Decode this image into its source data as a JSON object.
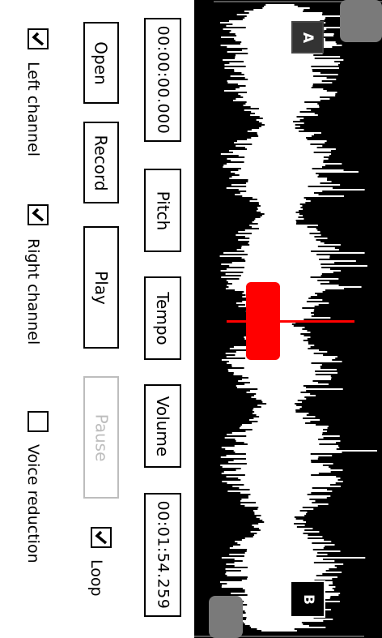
{
  "controls": {
    "open_label": "Open",
    "record_label": "Record",
    "play_label": "Play",
    "pause_label": "Pause",
    "pitch_label": "Pitch",
    "tempo_label": "Tempo",
    "volume_label": "Volume",
    "start_time": "00:00:00.000",
    "end_time": "00:01:54.259"
  },
  "checkboxes": {
    "left_channel": {
      "label": "Left channel",
      "checked": true
    },
    "right_channel": {
      "label": "Right channel",
      "checked": true
    },
    "voice_reduction": {
      "label": "Voice reduction",
      "checked": false
    },
    "loop": {
      "label": "Loop",
      "checked": true
    }
  },
  "waveform": {
    "marker_a": "A",
    "marker_b": "B",
    "playhead_color": "#ff0000",
    "wave_color": "#ffffff",
    "background_color": "#000000"
  }
}
